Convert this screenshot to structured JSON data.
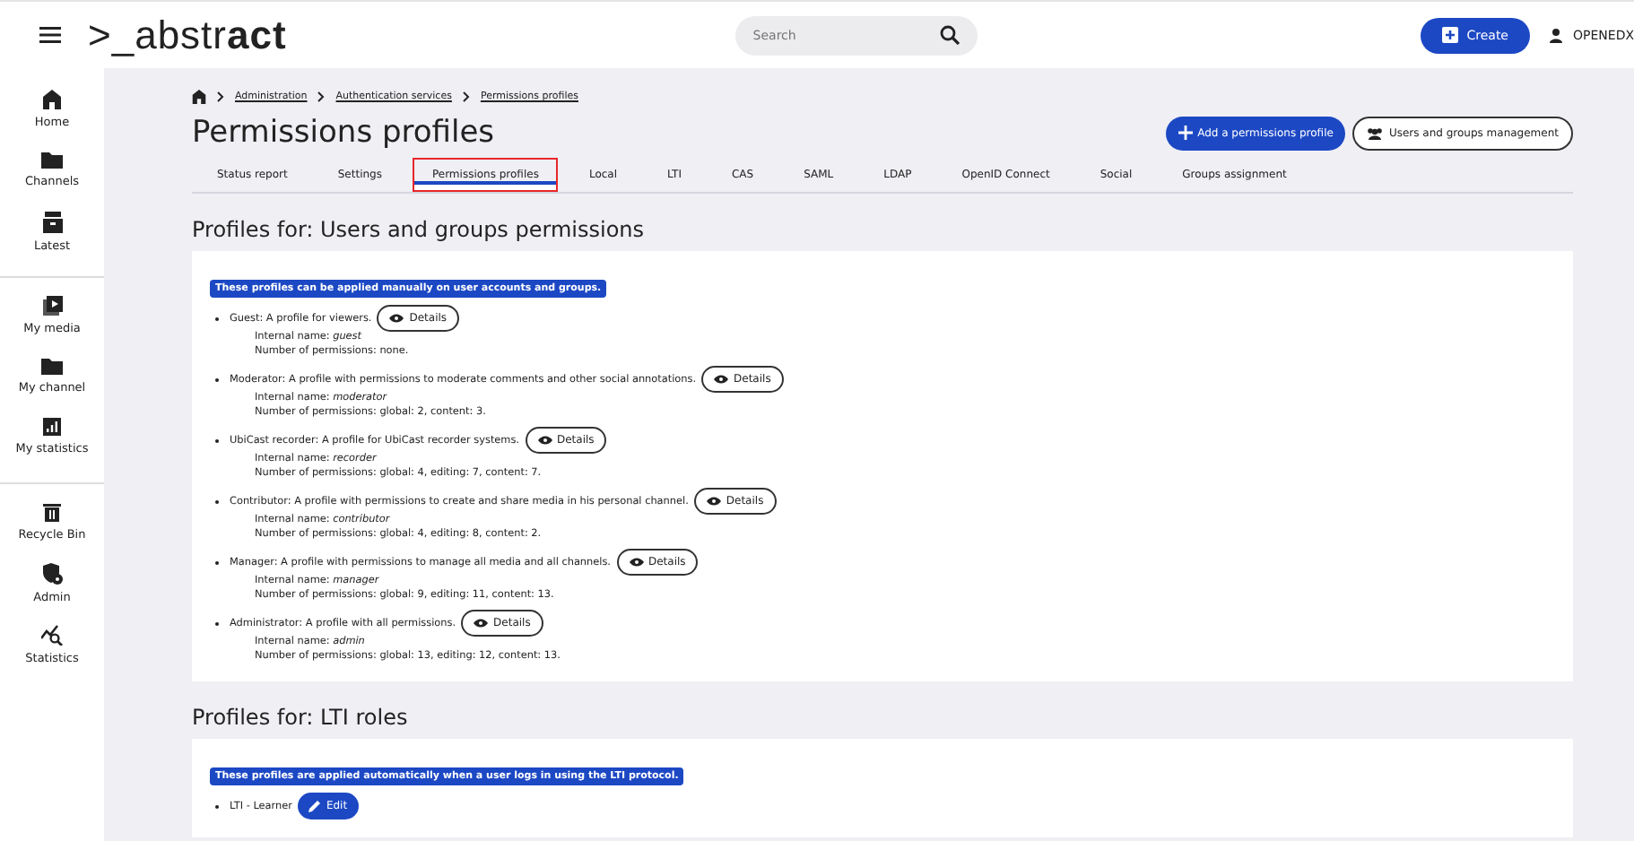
{
  "header": {
    "logo": ">_abstr**act**",
    "search": {
      "placeholder": "Search"
    },
    "create_button": "Create",
    "user": "OPENEDX"
  },
  "sidebar": {
    "groups": [
      {
        "items": [
          {
            "label": "Home"
          },
          {
            "label": "Channels"
          },
          {
            "label": "Latest"
          }
        ]
      },
      {
        "items": [
          {
            "label": "My media"
          },
          {
            "label": "My channel"
          },
          {
            "label": "My statistics"
          }
        ]
      },
      {
        "items": [
          {
            "label": "Recycle Bin"
          },
          {
            "label": "Admin"
          },
          {
            "label": "Statistics"
          }
        ]
      }
    ]
  },
  "breadcrumb": [
    "Administration",
    "Authentication services",
    "Permissions profiles"
  ],
  "title": "Permissions profiles",
  "actions": [
    {
      "label": "Add a permissions profile",
      "kind": "primary"
    },
    {
      "label": "Users and groups management",
      "kind": "outline"
    }
  ],
  "tabs": [
    {
      "label": "Status report",
      "selected": false,
      "highlighted": false
    },
    {
      "label": "Settings",
      "selected": false,
      "highlighted": false
    },
    {
      "label": "Permissions profiles",
      "selected": true,
      "highlighted": true
    },
    {
      "label": "Local",
      "selected": false,
      "highlighted": false
    },
    {
      "label": "LTI",
      "selected": false,
      "highlighted": false
    },
    {
      "label": "CAS",
      "selected": false,
      "highlighted": false
    },
    {
      "label": "SAML",
      "selected": false,
      "highlighted": false
    },
    {
      "label": "LDAP",
      "selected": false,
      "highlighted": false
    },
    {
      "label": "OpenID Connect",
      "selected": false,
      "highlighted": false
    },
    {
      "label": "Social",
      "selected": false,
      "highlighted": false
    },
    {
      "label": "Groups assignment",
      "selected": false,
      "highlighted": false
    }
  ],
  "sections": [
    {
      "title": "Profiles for: Users and groups permissions",
      "notice": "These profiles can be applied manually on user accounts and groups.",
      "profiles": [
        {
          "description": "Guest: A profile for viewers.",
          "button": {
            "label": "Details",
            "kind": "details"
          },
          "internal_name": "Internal name: *guest*",
          "permissions": "Number of permissions: none."
        },
        {
          "description": "Moderator: A profile with permissions to moderate comments and other social annotations.",
          "button": {
            "label": "Details",
            "kind": "details"
          },
          "internal_name": "Internal name: *moderator*",
          "permissions": "Number of permissions: global: 2, content: 3."
        },
        {
          "description": "UbiCast recorder: A profile for UbiCast recorder systems.",
          "button": {
            "label": "Details",
            "kind": "details"
          },
          "internal_name": "Internal name: *recorder*",
          "permissions": "Number of permissions: global: 4, editing: 7, content: 7."
        },
        {
          "description": "Contributor: A profile with permissions to create and share media in his personal channel.",
          "button": {
            "label": "Details",
            "kind": "details"
          },
          "internal_name": "Internal name: *contributor*",
          "permissions": "Number of permissions: global: 4, editing: 8, content: 2."
        },
        {
          "description": "Manager: A profile with permissions to manage all media and all channels.",
          "button": {
            "label": "Details",
            "kind": "details"
          },
          "internal_name": "Internal name: *manager*",
          "permissions": "Number of permissions: global: 9, editing: 11, content: 13."
        },
        {
          "description": "Administrator: A profile with all permissions.",
          "button": {
            "label": "Details",
            "kind": "details"
          },
          "internal_name": "Internal name: *admin*",
          "permissions": "Number of permissions: global: 13, editing: 12, content: 13."
        }
      ]
    },
    {
      "title": "Profiles for: LTI roles",
      "notice": "These profiles are applied automatically when a user logs in using the LTI protocol.",
      "profiles": [
        {
          "description": "LTI - Learner",
          "button": {
            "label": "Edit",
            "kind": "edit"
          }
        }
      ]
    }
  ]
}
